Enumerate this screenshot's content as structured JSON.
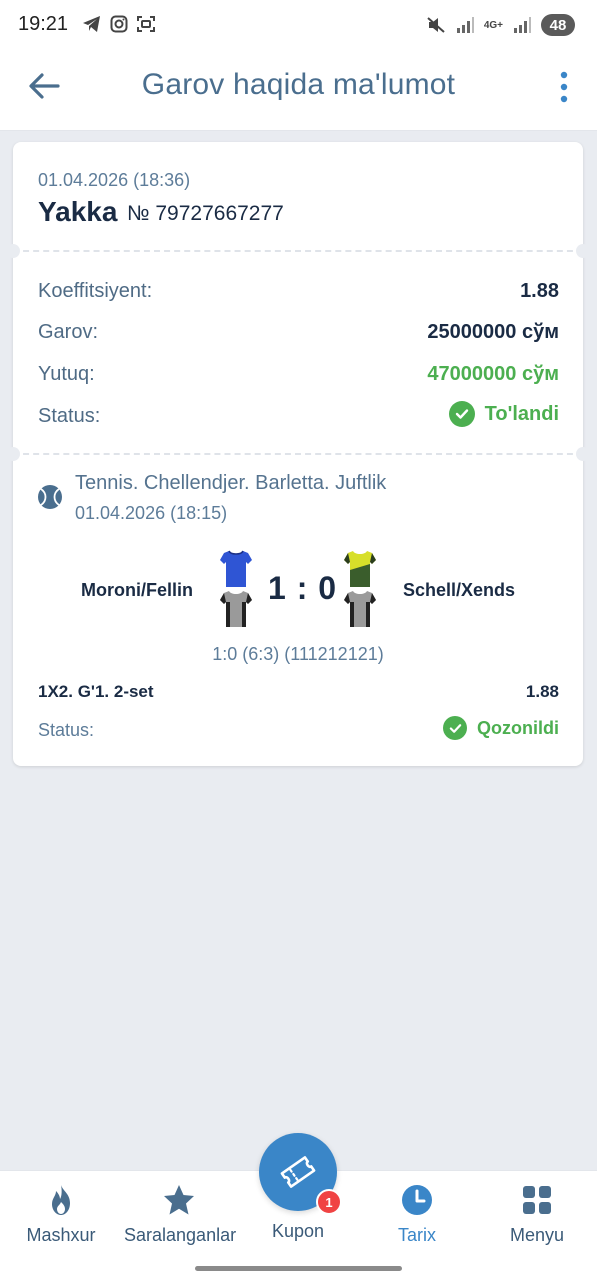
{
  "status_bar": {
    "time": "19:21",
    "battery": "48",
    "network": "4G+",
    "left_icons": [
      "telegram-icon",
      "instagram-icon",
      "scan-icon"
    ],
    "right_icons": [
      "mute-icon",
      "signal-icon",
      "signal-icon"
    ]
  },
  "app_bar": {
    "title": "Garov haqida ma'lumot",
    "back_icon": "arrow-left-icon",
    "menu_icon": "more-vertical-icon"
  },
  "bet": {
    "date": "01.04.2026 (18:36)",
    "type": "Yakka",
    "number": "№ 79727667277",
    "rows": {
      "coefficient_label": "Koeffitsiyent:",
      "coefficient_value": "1.88",
      "stake_label": "Garov:",
      "stake_value": "25000000 сўм",
      "win_label": "Yutuq:",
      "win_value": "47000000 сўм",
      "status_label": "Status:",
      "status_value": "To'landi"
    }
  },
  "event": {
    "sport_icon": "tennis-ball-icon",
    "title": "Tennis. Chellendjer. Barletta. Juftlik",
    "date": "01.04.2026 (18:15)",
    "team1": "Moroni/Fellin",
    "team2": "Schell/Xends",
    "score": "1 : 0",
    "score_detail": "1:0 (6:3) (111212121)",
    "market": "1X2. G'1. 2-set",
    "market_odd": "1.88",
    "status_label": "Status:",
    "status_value": "Qozonildi"
  },
  "bottom_nav": {
    "items": [
      {
        "label": "Mashxur",
        "icon": "fire-icon"
      },
      {
        "label": "Saralanganlar",
        "icon": "star-icon"
      },
      {
        "label": "Kupon",
        "icon": "ticket-icon",
        "badge": "1"
      },
      {
        "label": "Tarix",
        "icon": "clock-icon"
      },
      {
        "label": "Menyu",
        "icon": "grid-icon"
      }
    ]
  },
  "colors": {
    "accent": "#3a86c8",
    "success": "#4caf50",
    "badge": "#f04343",
    "background": "#e9ecf1"
  }
}
